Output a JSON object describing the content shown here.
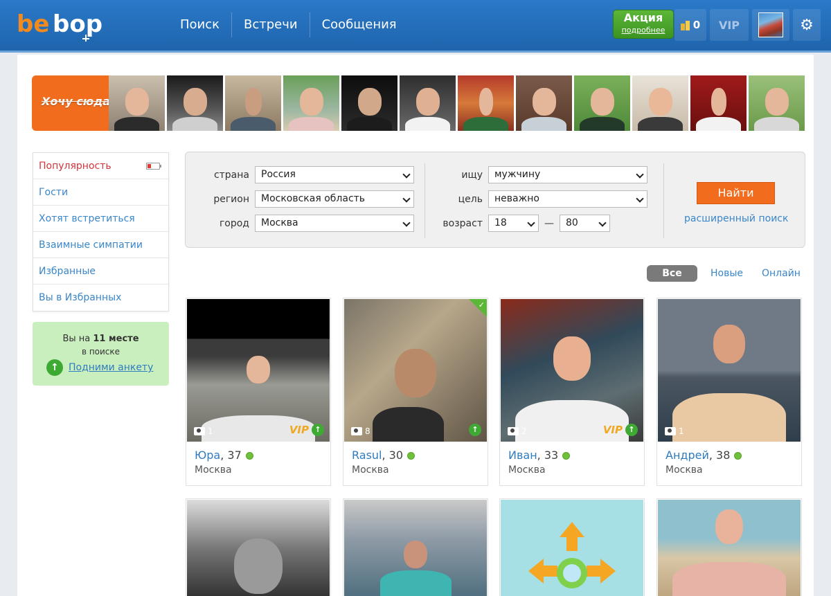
{
  "header": {
    "logo_text": "bebop",
    "nav": [
      "Поиск",
      "Встречи",
      "Сообщения"
    ],
    "promo_title": "Акция",
    "promo_sub": "подробнее",
    "coins": "0",
    "vip_label": "VIP"
  },
  "strip": {
    "cta_label": "Хочу сюда!"
  },
  "sidebar": {
    "items": [
      {
        "label": "Популярность"
      },
      {
        "label": "Гости"
      },
      {
        "label": "Хотят встретиться"
      },
      {
        "label": "Взаимные симпатии"
      },
      {
        "label": "Избранные"
      },
      {
        "label": "Вы в Избранных"
      }
    ],
    "rank_prefix": "Вы на",
    "rank_place": "11 месте",
    "rank_suffix": "в поиске",
    "raise_label": "Подними анкету"
  },
  "search": {
    "country_label": "страна",
    "country_value": "Россия",
    "region_label": "регион",
    "region_value": "Московская область",
    "city_label": "город",
    "city_value": "Москва",
    "seek_label": "ищу",
    "seek_value": "мужчину",
    "goal_label": "цель",
    "goal_value": "неважно",
    "age_label": "возраст",
    "age_from": "18",
    "age_dash": "—",
    "age_to": "80",
    "find_button": "Найти",
    "advanced_link": "расширенный поиск"
  },
  "tabs": [
    "Все",
    "Новые",
    "Онлайн"
  ],
  "cards": [
    {
      "name": "Юра",
      "age": ", 37",
      "city": "Москва",
      "photos": "1"
    },
    {
      "name": "Rasul",
      "age": ", 30",
      "city": "Москва",
      "photos": "8"
    },
    {
      "name": "Иван",
      "age": ", 33",
      "city": "Москва",
      "photos": "2"
    },
    {
      "name": "Андрей",
      "age": ", 38",
      "city": "Москва",
      "photos": "1"
    }
  ],
  "badges": {
    "vip": "VIP"
  }
}
